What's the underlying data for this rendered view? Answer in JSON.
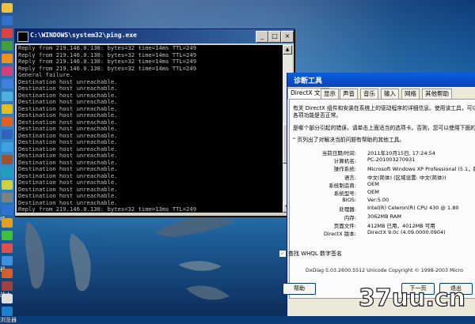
{
  "desktop": {
    "icons": [
      {
        "label": "",
        "color": "#f0c040"
      },
      {
        "label": "",
        "color": "#3070d0"
      },
      {
        "label": "",
        "color": "#e04040"
      },
      {
        "label": "",
        "color": "#40a040"
      },
      {
        "label": "",
        "color": "#f09020"
      },
      {
        "label": "",
        "color": "#d04080"
      },
      {
        "label": "",
        "color": "#4080e0"
      },
      {
        "label": "",
        "color": "#50b0e0"
      },
      {
        "label": "",
        "color": "#e0c020"
      },
      {
        "label": "",
        "color": "#e06020"
      },
      {
        "label": "",
        "color": "#3060c0"
      },
      {
        "label": "",
        "color": "#40a0e0"
      },
      {
        "label": "",
        "color": "#a05030"
      },
      {
        "label": "",
        "color": "#20a0c0"
      },
      {
        "label": "",
        "color": "#d0d040"
      },
      {
        "label": "",
        "color": "#808080"
      },
      {
        "label": "络",
        "color": "#3070d0"
      },
      {
        "label": "",
        "color": "#e0a020"
      },
      {
        "label": "",
        "color": "#40c040"
      },
      {
        "label": "",
        "color": "#e05050"
      },
      {
        "label": "器",
        "color": "#4090e0"
      },
      {
        "label": "",
        "color": "#d06030"
      },
      {
        "label": "战士",
        "color": "#a04040"
      },
      {
        "label": "",
        "color": "#e0e0e0"
      },
      {
        "label": "浏览器",
        "color": "#2080d0"
      }
    ]
  },
  "cmd": {
    "title": "C:\\WINDOWS\\system32\\ping.exe",
    "lines": [
      "Reply from 219.146.0.130: bytes=32 time=14ms TTL=249",
      "Reply from 219.146.0.130: bytes=32 time=14ms TTL=249",
      "Reply from 219.146.0.130: bytes=32 time=14ms TTL=249",
      "Reply from 219.146.0.130: bytes=32 time=14ms TTL=249",
      "General failure.",
      "Destination host unreachable.",
      "Destination host unreachable.",
      "Destination host unreachable.",
      "Destination host unreachable.",
      "Destination host unreachable.",
      "Destination host unreachable.",
      "Destination host unreachable.",
      "Destination host unreachable.",
      "Destination host unreachable.",
      "Destination host unreachable.",
      "Destination host unreachable.",
      "Destination host unreachable.",
      "Destination host unreachable.",
      "Destination host unreachable.",
      "Destination host unreachable.",
      "Destination host unreachable.",
      "Destination host unreachable.",
      "Destination host unreachable.",
      "Destination host unreachable.",
      "Reply from 219.146.0.130: bytes=32 time=13ms TTL=249"
    ],
    "minimize": "_",
    "maximize": "□",
    "close": "×"
  },
  "dxdiag": {
    "title": "诊断工具",
    "tabs": [
      "DirectX 文件",
      "显示",
      "声音",
      "音乐",
      "输入",
      "网络",
      "其他帮助"
    ],
    "intro": [
      "有关 DirectX 组件和安装在系统上的驱动程序的详细信息。使用该工具，可以运",
      "各项功能是否正常。",
      "是哪个部分引起的错误，请单击上面适当的选项卡。否则，您可以使用下面的 \"",
      "\" 页列出了对解决当前问题有帮助的其他工具。"
    ],
    "system_info": [
      {
        "key": "当前日期/时间:",
        "value": "2011年10月15日,  17:24:54"
      },
      {
        "key": "计算机名:",
        "value": "PC-201003270931"
      },
      {
        "key": "操作系统:",
        "value": "Microsoft Windows XP Professional (5.1，版本"
      },
      {
        "key": "语言:",
        "value": "中文(简体) (区域设置: 中文(简体))"
      },
      {
        "key": "系统制造商:",
        "value": "OEM"
      },
      {
        "key": "系统型号:",
        "value": "OEM"
      },
      {
        "key": "BIOS:",
        "value": "Ver:5.00"
      },
      {
        "key": "处理器:",
        "value": "Intel(R) Celeron(R) CPU        430  @ 1.80"
      },
      {
        "key": "内存:",
        "value": "3062MB RAM"
      },
      {
        "key": "页面文件:",
        "value": "412MB 已用，4012MB 可用"
      },
      {
        "key": "DirectX 版本:",
        "value": "DirectX 9.0c (4.09.0000.0904)"
      }
    ],
    "checkbox_label": "查找 WHQL 数字签名",
    "checkbox_checked": "✓",
    "footer": "DxDiag 5.03.2600.5512 Unicode  Copyright © 1998-2003 Micro",
    "buttons": {
      "help": "帮助",
      "next": "下一页",
      "exit": "退出"
    }
  },
  "watermark": {
    "text": "37uu.cn"
  }
}
